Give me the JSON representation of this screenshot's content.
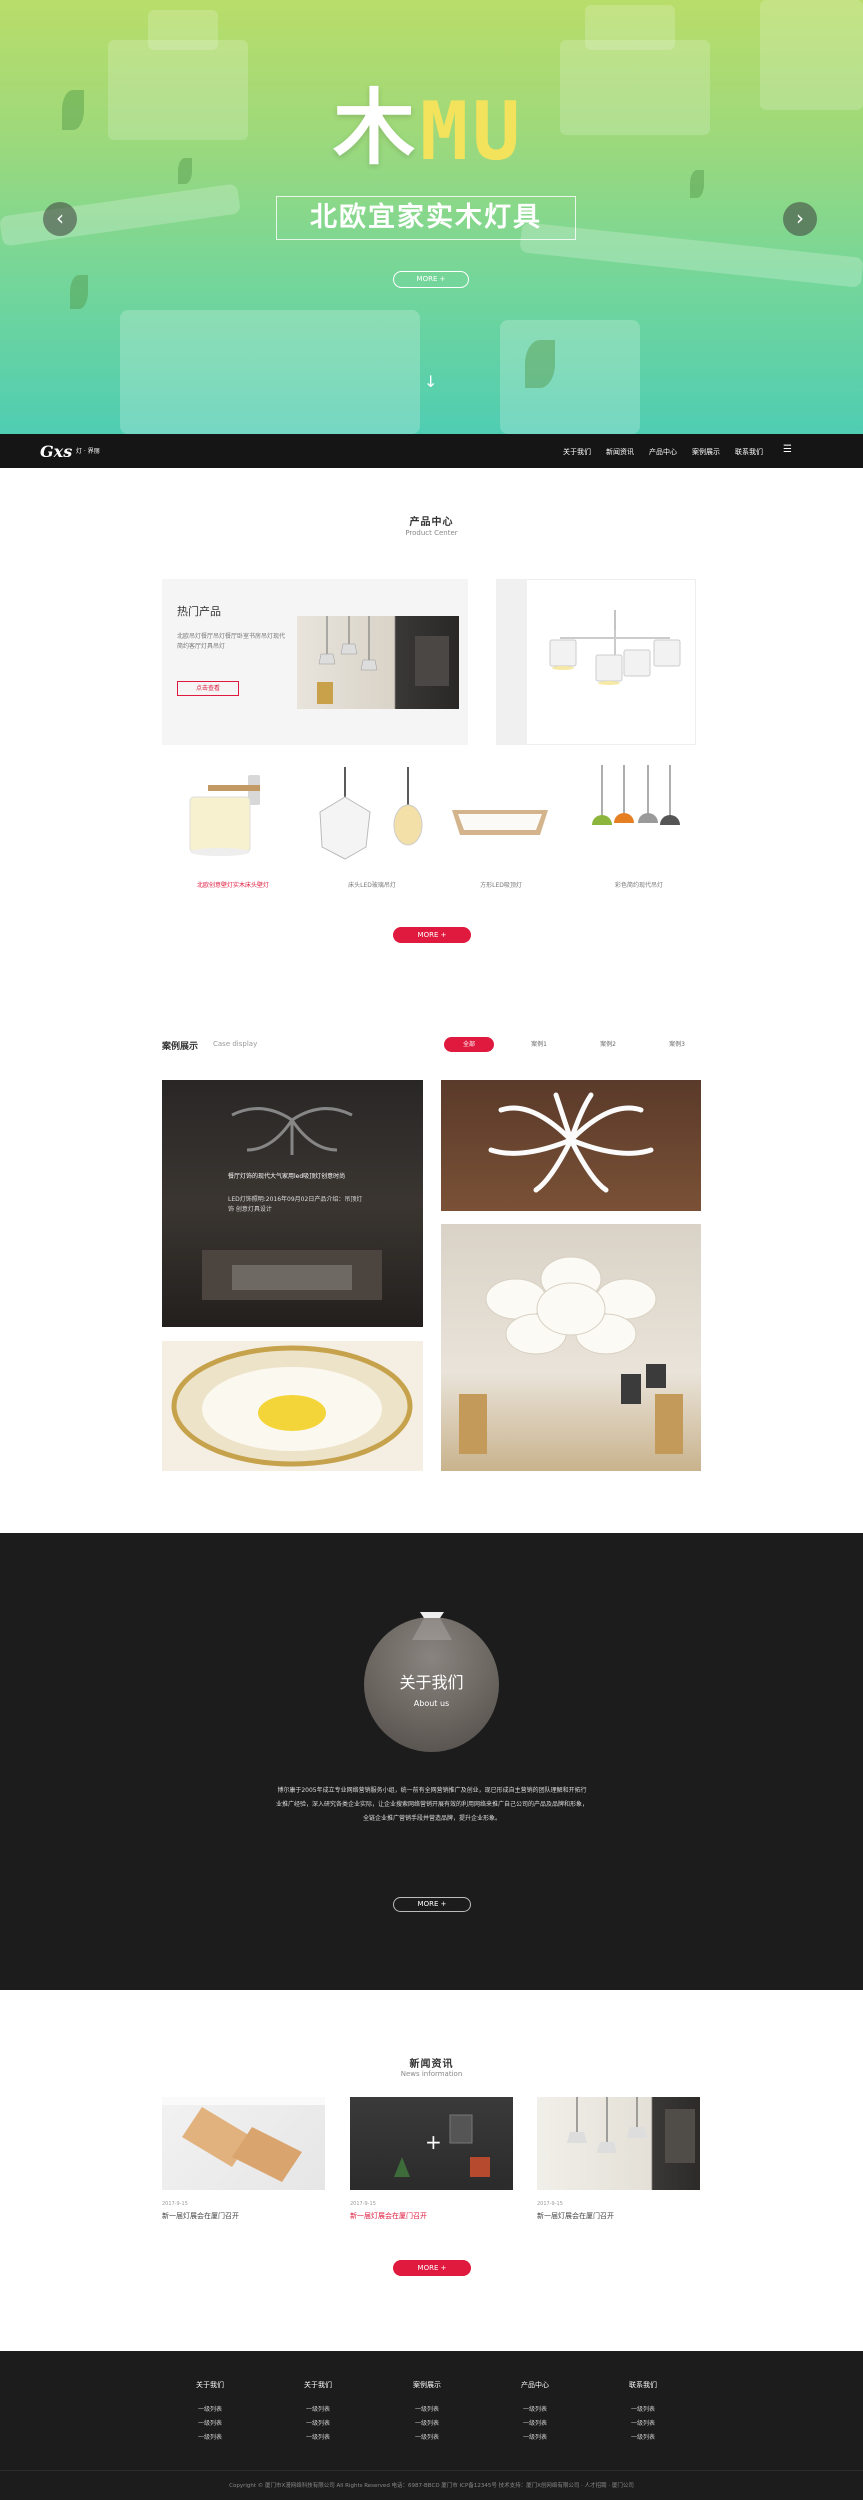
{
  "hero": {
    "title_cn": "木",
    "title_en": "MU",
    "subtitle": "北欧宜家实木灯具",
    "more": "MORE +",
    "prev": "‹",
    "next": "›",
    "down": "↓"
  },
  "nav": {
    "logo": "Gxs",
    "logo_sub": "灯 · 界丽",
    "items": [
      "关于我们",
      "新闻资讯",
      "产品中心",
      "案例展示",
      "联系我们"
    ],
    "menu_icon": "☰"
  },
  "products": {
    "title": "产品中心",
    "subtitle": "Product Center",
    "hot_title": "热门产品",
    "hot_desc": "北欧吊灯餐厅吊灯餐厅卧室书房吊灯现代简约客厅灯具吊灯",
    "hot_button": "点击查看",
    "items": [
      {
        "label": "北欧创意壁灯实木床头壁灯",
        "highlight": true
      },
      {
        "label": "床头LED玻璃吊灯",
        "highlight": false
      },
      {
        "label": "方形LED吸顶灯",
        "highlight": false
      },
      {
        "label": "彩色简约现代吊灯",
        "highlight": false
      }
    ],
    "more": "MORE +"
  },
  "cases": {
    "title": "案例展示",
    "title_en": "Case display",
    "tabs": [
      "全部",
      "案例1",
      "案例2",
      "案例3"
    ],
    "active_tab": 0,
    "overlay_title": "餐厅灯饰的现代大气家用led吸顶灯创意时尚",
    "overlay_desc": "LED灯饰照明:2016年09月02日产品介绍：吊顶灯饰 创意灯具设计"
  },
  "about": {
    "title": "关于我们",
    "subtitle": "About us",
    "desc": "博尔康于2005年成立专业网络营销服务小组，统一前有全网营销推广及创业，现已形成自主营销的团队理解和开拓行业推广经验，深入研究各类企业实际，让企业搜索网络营销开展有效的利用网络来推广自己公司的产品及品牌和形象，全链企业推广营销手段并营造品牌，提升企业形象。",
    "more": "MORE +"
  },
  "news": {
    "title": "新闻资讯",
    "subtitle": "News information",
    "items": [
      {
        "date": "2017-9-15",
        "title": "新一届灯展会在厦门召开",
        "highlight": false
      },
      {
        "date": "2017-9-15",
        "title": "新一届灯展会在厦门召开",
        "highlight": true
      },
      {
        "date": "2017-9-15",
        "title": "新一届灯展会在厦门召开",
        "highlight": false
      }
    ],
    "more": "MORE +"
  },
  "footer": {
    "columns": [
      {
        "title": "关于我们",
        "items": [
          "一级列表",
          "一级列表",
          "一级列表"
        ]
      },
      {
        "title": "关于我们",
        "items": [
          "一级列表",
          "一级列表",
          "一级列表"
        ]
      },
      {
        "title": "案例展示",
        "items": [
          "一级列表",
          "一级列表",
          "一级列表"
        ]
      },
      {
        "title": "产品中心",
        "items": [
          "一级列表",
          "一级列表",
          "一级列表"
        ]
      },
      {
        "title": "联系我们",
        "items": [
          "一级列表",
          "一级列表",
          "一级列表"
        ]
      }
    ],
    "copyright": "Copyright © 厦门市X漫网络科技有限公司 All Rights Reserved 电话：6987-BBCD 厦门市 ICP备12345号 技术支持：厦门X创网络有限公司 · 人才招聘 · 厦门公司"
  },
  "colors": {
    "accent": "#e01a3e",
    "dark": "#1c1c1c"
  }
}
